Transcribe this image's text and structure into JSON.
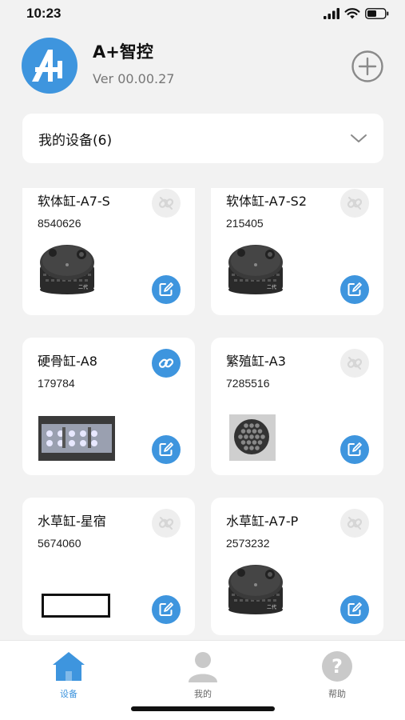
{
  "status_bar": {
    "time": "10:23"
  },
  "app": {
    "title": "A+智控",
    "version": "Ver 00.00.27"
  },
  "device_header": {
    "label": "我的设备(6)"
  },
  "devices": [
    {
      "name": "软体缸-A7-S",
      "id": "8540626",
      "linked": false,
      "image": "round-controller"
    },
    {
      "name": "软体缸-A7-S2",
      "id": "215405",
      "linked": false,
      "image": "round-controller"
    },
    {
      "name": "硬骨缸-A8",
      "id": "179784",
      "linked": true,
      "image": "led-panel"
    },
    {
      "name": "繁殖缸-A3",
      "id": "7285516",
      "linked": false,
      "image": "hex-light"
    },
    {
      "name": "水草缸-星宿",
      "id": "5674060",
      "linked": false,
      "image": "rect-outline"
    },
    {
      "name": "水草缸-A7-P",
      "id": "2573232",
      "linked": false,
      "image": "round-controller"
    }
  ],
  "image_caption": "二代",
  "tabs": [
    {
      "label": "设备",
      "icon": "home-icon",
      "active": true
    },
    {
      "label": "我的",
      "icon": "user-icon",
      "active": false
    },
    {
      "label": "帮助",
      "icon": "help-icon",
      "active": false
    }
  ],
  "colors": {
    "accent": "#3e95de",
    "background": "#f2f2f2",
    "muted": "#d0d0d0"
  }
}
